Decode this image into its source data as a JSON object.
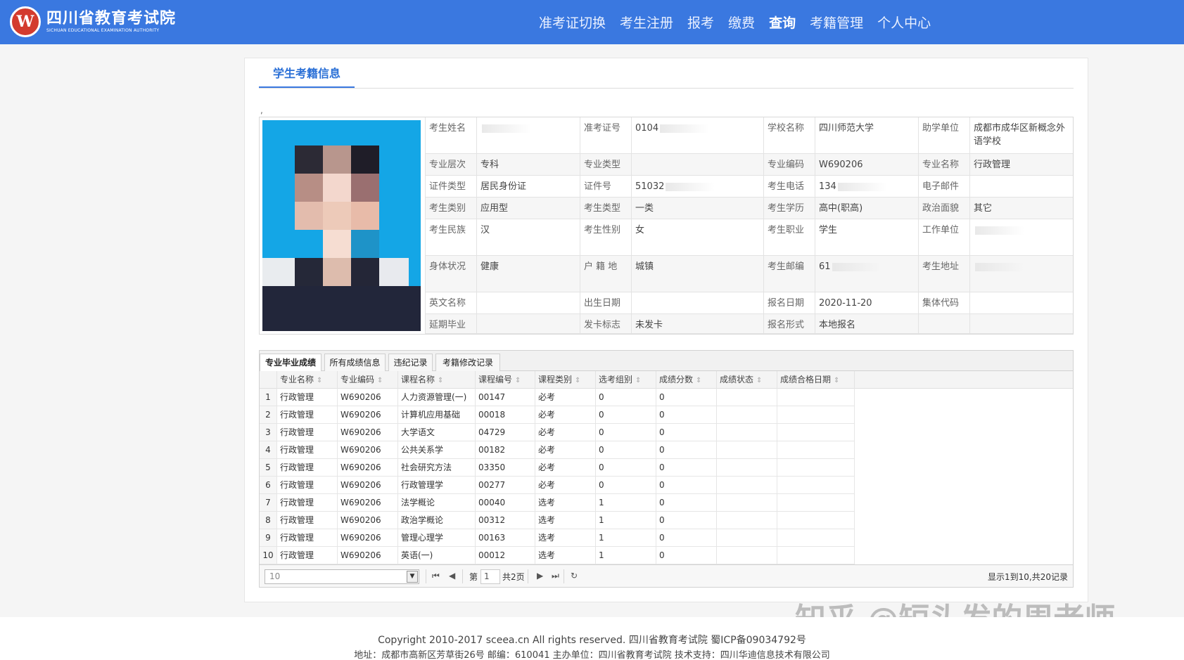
{
  "header": {
    "logo_cn": "四川省教育考试院",
    "logo_en": "SICHUAN EDUCATIONAL EXAMINATION AUTHORITY",
    "nav": [
      "准考证切换",
      "考生注册",
      "报考",
      "缴费",
      "查询",
      "考籍管理",
      "个人中心"
    ],
    "active_nav": "查询"
  },
  "page_tab": "学生考籍信息",
  "comma": ",",
  "info": {
    "rows": [
      [
        "考生姓名",
        "",
        "准考证号",
        "0104",
        "学校名称",
        "四川师范大学",
        "助学单位",
        "成都市成华区新概念外语学校"
      ],
      [
        "专业层次",
        "专科",
        "专业类型",
        "",
        "专业编码",
        "W690206",
        "专业名称",
        "行政管理"
      ],
      [
        "证件类型",
        "居民身份证",
        "证件号",
        "51032",
        "考生电话",
        "134",
        "电子邮件",
        ""
      ],
      [
        "考生类别",
        "应用型",
        "考生类型",
        "一类",
        "考生学历",
        "高中(职高)",
        "政治面貌",
        "其它"
      ],
      [
        "考生民族",
        "汉",
        "考生性别",
        "女",
        "考生职业",
        "学生",
        "工作单位",
        ""
      ],
      [
        "身体状况",
        "健康",
        "户 籍 地",
        "城镇",
        "考生邮编",
        "61",
        "考生地址",
        ""
      ],
      [
        "英文名称",
        "",
        "出生日期",
        "",
        "报名日期",
        "2020-11-20",
        "集体代码",
        ""
      ],
      [
        "延期毕业",
        "",
        "发卡标志",
        "未发卡",
        "报名形式",
        "本地报名",
        "",
        ""
      ]
    ]
  },
  "grades": {
    "tabs": [
      "专业毕业成绩",
      "所有成绩信息",
      "违纪记录",
      "考籍修改记录"
    ],
    "columns": [
      "专业名称",
      "专业编码",
      "课程名称",
      "课程编号",
      "课程类别",
      "选考组别",
      "成绩分数",
      "成绩状态",
      "成绩合格日期"
    ],
    "rows": [
      [
        "1",
        "行政管理",
        "W690206",
        "人力资源管理(一)",
        "00147",
        "必考",
        "0",
        "0",
        "",
        ""
      ],
      [
        "2",
        "行政管理",
        "W690206",
        "计算机应用基础",
        "00018",
        "必考",
        "0",
        "0",
        "",
        ""
      ],
      [
        "3",
        "行政管理",
        "W690206",
        "大学语文",
        "04729",
        "必考",
        "0",
        "0",
        "",
        ""
      ],
      [
        "4",
        "行政管理",
        "W690206",
        "公共关系学",
        "00182",
        "必考",
        "0",
        "0",
        "",
        ""
      ],
      [
        "5",
        "行政管理",
        "W690206",
        "社会研究方法",
        "03350",
        "必考",
        "0",
        "0",
        "",
        ""
      ],
      [
        "6",
        "行政管理",
        "W690206",
        "行政管理学",
        "00277",
        "必考",
        "0",
        "0",
        "",
        ""
      ],
      [
        "7",
        "行政管理",
        "W690206",
        "法学概论",
        "00040",
        "选考",
        "1",
        "0",
        "",
        ""
      ],
      [
        "8",
        "行政管理",
        "W690206",
        "政治学概论",
        "00312",
        "选考",
        "1",
        "0",
        "",
        ""
      ],
      [
        "9",
        "行政管理",
        "W690206",
        "管理心理学",
        "00163",
        "选考",
        "1",
        "0",
        "",
        ""
      ],
      [
        "10",
        "行政管理",
        "W690206",
        "英语(一)",
        "00012",
        "选考",
        "1",
        "0",
        "",
        ""
      ]
    ],
    "pager": {
      "page_size": "10",
      "page_prefix": "第",
      "page_value": "1",
      "page_total": "共2页",
      "info": "显示1到10,共20记录"
    }
  },
  "footer": {
    "line1": "Copyright 2010-2017 sceea.cn All rights reserved. 四川省教育考试院 蜀ICP备09034792号",
    "line2": "地址：成都市高新区芳草街26号 邮编：610041 主办单位：四川省教育考试院 技术支持：四川华迪信息技术有限公司"
  },
  "watermark": "知乎 @短头发的周老师",
  "colors": {
    "header_bg": "#3a78e0",
    "photo_bg": "#14a6e6",
    "logo_red": "#d33b2e"
  }
}
